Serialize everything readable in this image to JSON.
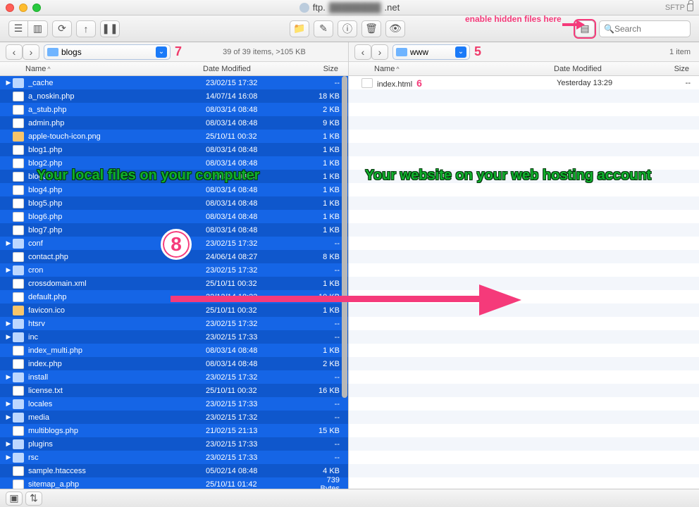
{
  "window": {
    "title_prefix": "ftp.",
    "title_suffix": ".net",
    "protocol": "SFTP"
  },
  "search": {
    "placeholder": "Search"
  },
  "annotations": {
    "left_label": "Your local files on your computer",
    "right_label": "Your website on your web hosting account",
    "hidden_hint": "enable hidden files here",
    "num5": "5",
    "num6": "6",
    "num7": "7",
    "num8": "8"
  },
  "left": {
    "path": "blogs",
    "status": "39 of 39 items, >105 KB",
    "columns": {
      "name": "Name",
      "date": "Date Modified",
      "size": "Size"
    },
    "files": [
      {
        "name": "_cache",
        "date": "23/02/15 17:32",
        "size": "--",
        "type": "folder",
        "exp": true
      },
      {
        "name": "a_noskin.php",
        "date": "14/07/14 16:08",
        "size": "18 KB",
        "type": "file"
      },
      {
        "name": "a_stub.php",
        "date": "08/03/14 08:48",
        "size": "2 KB",
        "type": "file"
      },
      {
        "name": "admin.php",
        "date": "08/03/14 08:48",
        "size": "9 KB",
        "type": "file"
      },
      {
        "name": "apple-touch-icon.png",
        "date": "25/10/11 00:32",
        "size": "1 KB",
        "type": "img"
      },
      {
        "name": "blog1.php",
        "date": "08/03/14 08:48",
        "size": "1 KB",
        "type": "file"
      },
      {
        "name": "blog2.php",
        "date": "08/03/14 08:48",
        "size": "1 KB",
        "type": "file"
      },
      {
        "name": "blog3.php",
        "date": "08/03/14 08:48",
        "size": "1 KB",
        "type": "file"
      },
      {
        "name": "blog4.php",
        "date": "08/03/14 08:48",
        "size": "1 KB",
        "type": "file"
      },
      {
        "name": "blog5.php",
        "date": "08/03/14 08:48",
        "size": "1 KB",
        "type": "file"
      },
      {
        "name": "blog6.php",
        "date": "08/03/14 08:48",
        "size": "1 KB",
        "type": "file"
      },
      {
        "name": "blog7.php",
        "date": "08/03/14 08:48",
        "size": "1 KB",
        "type": "file"
      },
      {
        "name": "conf",
        "date": "23/02/15 17:32",
        "size": "--",
        "type": "folder",
        "exp": true
      },
      {
        "name": "contact.php",
        "date": "24/06/14 08:27",
        "size": "8 KB",
        "type": "file"
      },
      {
        "name": "cron",
        "date": "23/02/15 17:32",
        "size": "--",
        "type": "folder",
        "exp": true
      },
      {
        "name": "crossdomain.xml",
        "date": "25/10/11 00:32",
        "size": "1 KB",
        "type": "file"
      },
      {
        "name": "default.php",
        "date": "22/12/14 18:23",
        "size": "10 KB",
        "type": "file"
      },
      {
        "name": "favicon.ico",
        "date": "25/10/11 00:32",
        "size": "1 KB",
        "type": "ico"
      },
      {
        "name": "htsrv",
        "date": "23/02/15 17:32",
        "size": "--",
        "type": "folder",
        "exp": true
      },
      {
        "name": "inc",
        "date": "23/02/15 17:33",
        "size": "--",
        "type": "folder",
        "exp": true
      },
      {
        "name": "index_multi.php",
        "date": "08/03/14 08:48",
        "size": "1 KB",
        "type": "file"
      },
      {
        "name": "index.php",
        "date": "08/03/14 08:48",
        "size": "2 KB",
        "type": "file"
      },
      {
        "name": "install",
        "date": "23/02/15 17:32",
        "size": "--",
        "type": "folder",
        "exp": true
      },
      {
        "name": "license.txt",
        "date": "25/10/11 00:32",
        "size": "16 KB",
        "type": "file"
      },
      {
        "name": "locales",
        "date": "23/02/15 17:33",
        "size": "--",
        "type": "folder",
        "exp": true
      },
      {
        "name": "media",
        "date": "23/02/15 17:32",
        "size": "--",
        "type": "folder",
        "exp": true
      },
      {
        "name": "multiblogs.php",
        "date": "21/02/15 21:13",
        "size": "15 KB",
        "type": "file"
      },
      {
        "name": "plugins",
        "date": "23/02/15 17:33",
        "size": "--",
        "type": "folder",
        "exp": true
      },
      {
        "name": "rsc",
        "date": "23/02/15 17:33",
        "size": "--",
        "type": "folder",
        "exp": true
      },
      {
        "name": "sample.htaccess",
        "date": "05/02/14 08:48",
        "size": "4 KB",
        "type": "file"
      },
      {
        "name": "sitemap_a.php",
        "date": "25/10/11 01:42",
        "size": "739 Bytes",
        "type": "file"
      }
    ]
  },
  "right": {
    "path": "www",
    "status": "1 item",
    "columns": {
      "name": "Name",
      "date": "Date Modified",
      "size": "Size"
    },
    "files": [
      {
        "name": "index.html",
        "date": "Yesterday 13:29",
        "size": "--",
        "type": "file"
      }
    ]
  }
}
